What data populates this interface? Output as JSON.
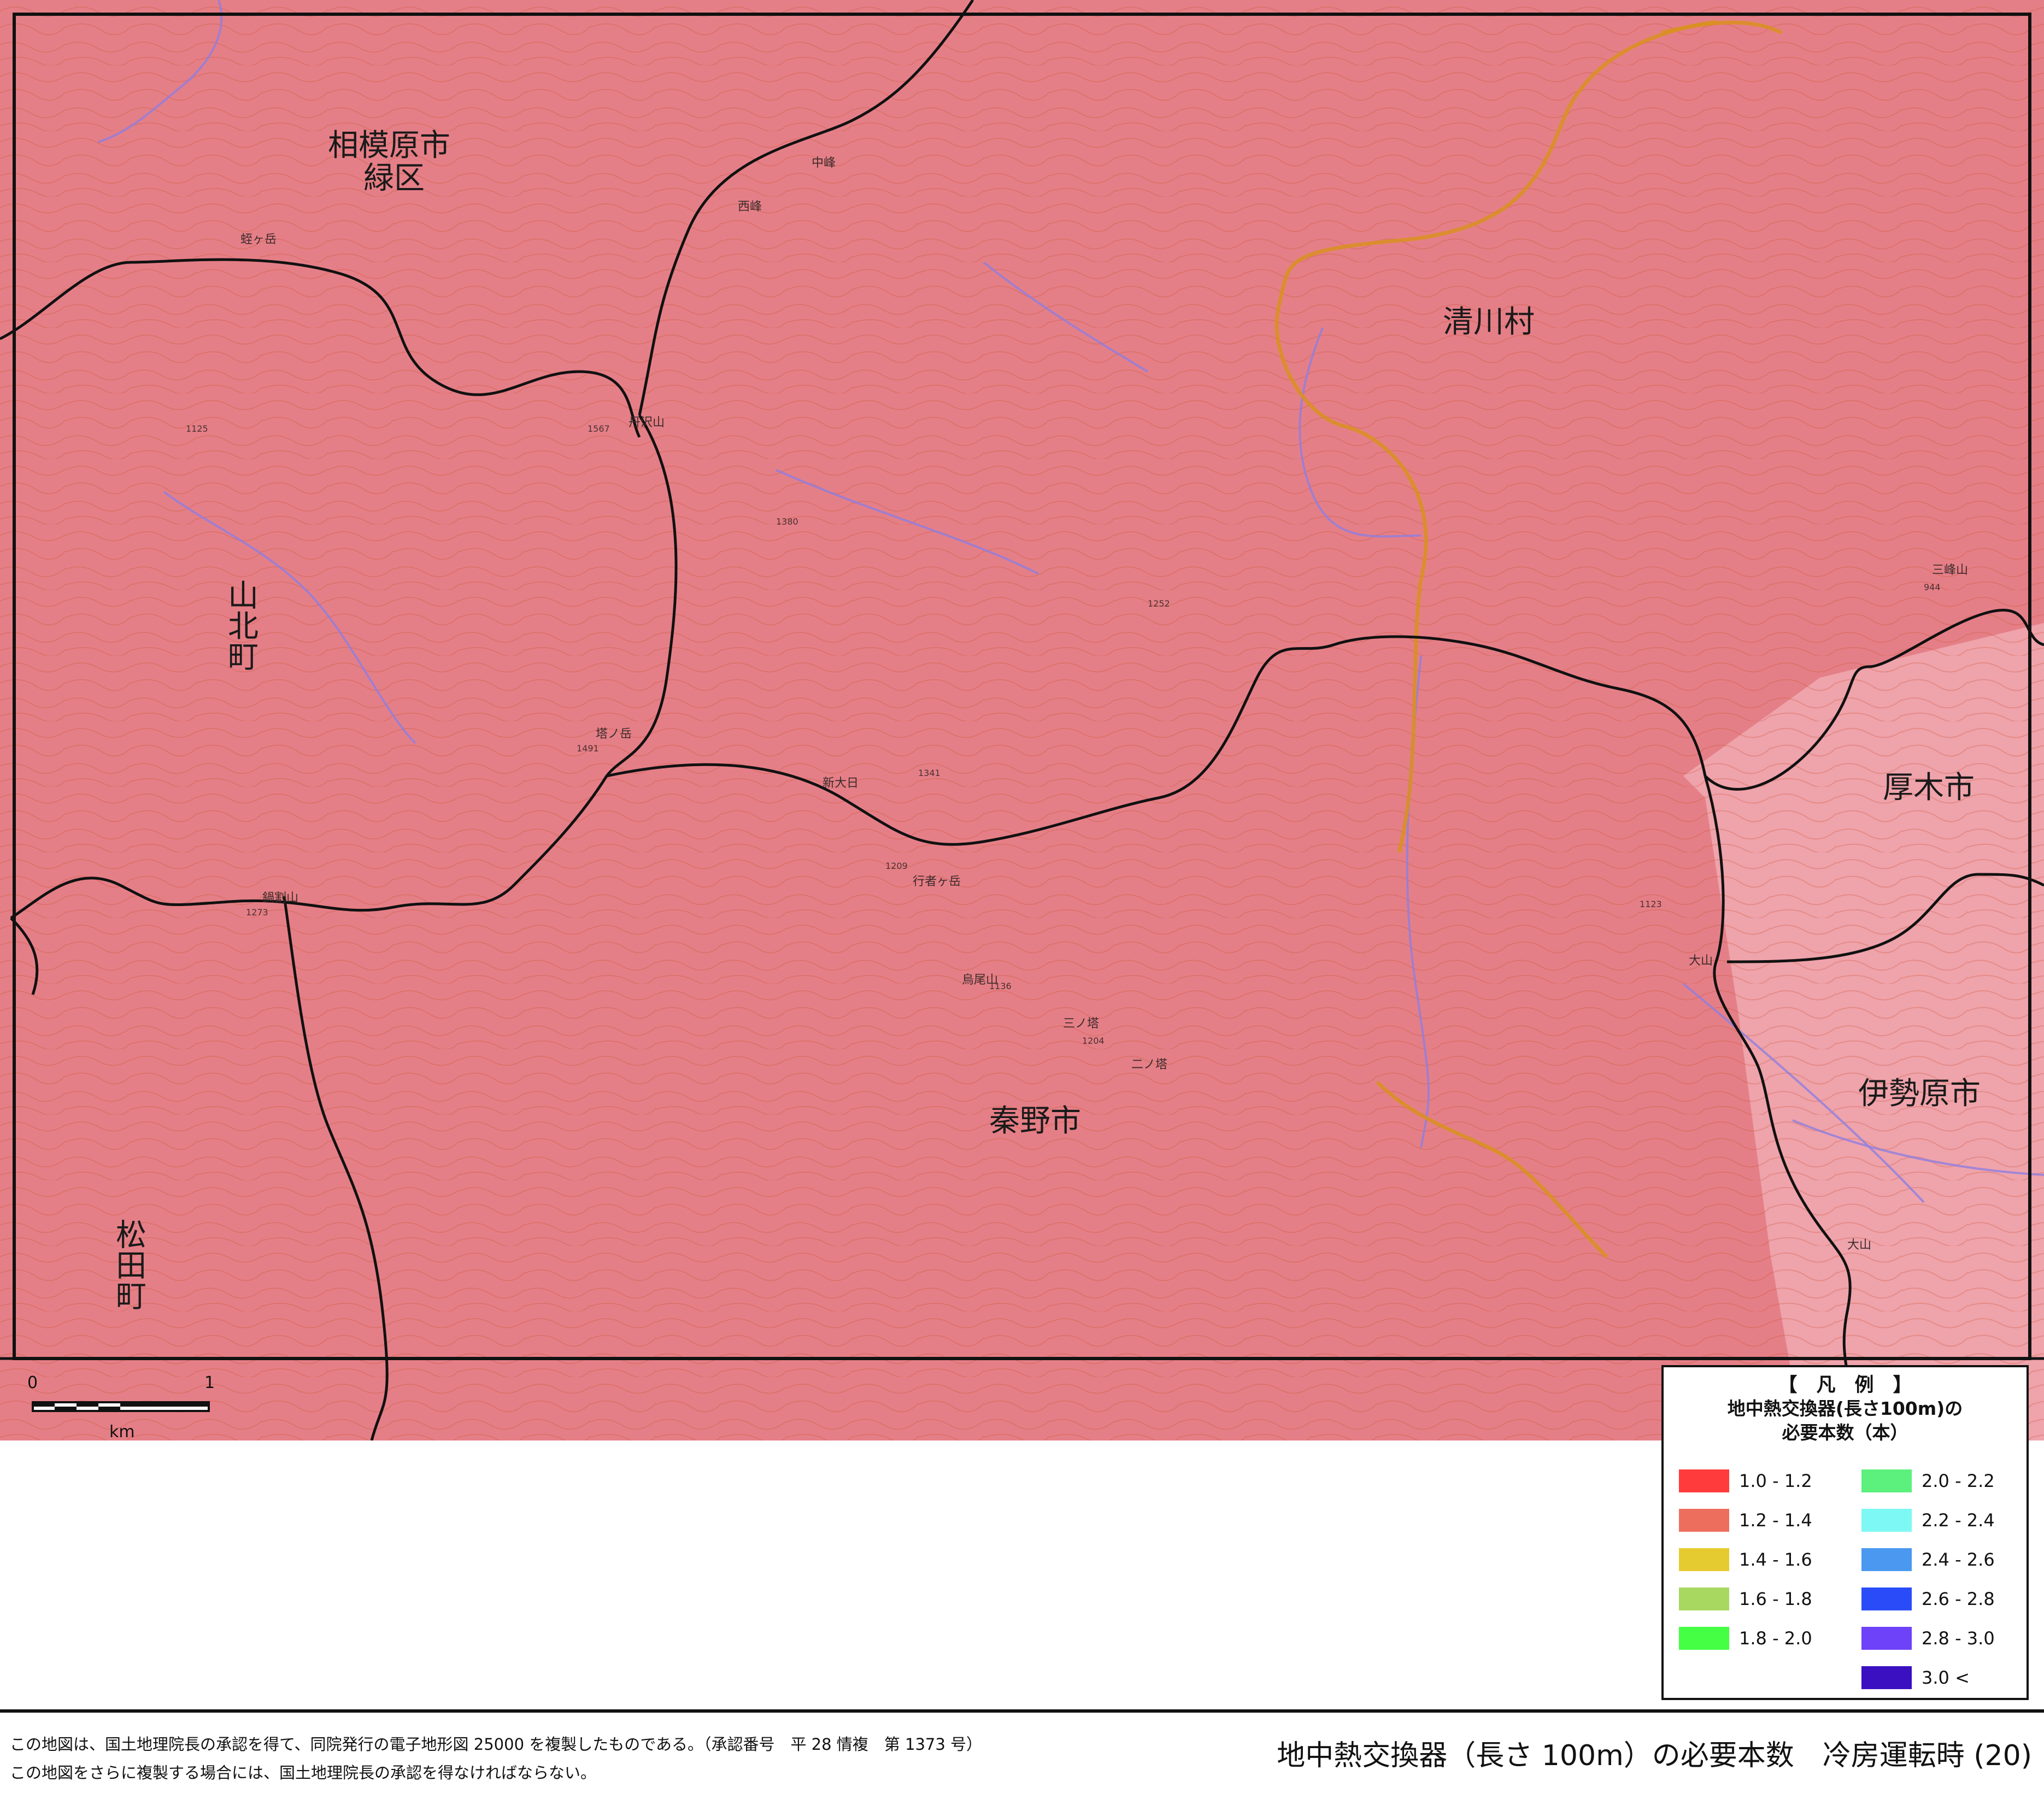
{
  "map": {
    "places": [
      {
        "name": "相模原市"
      },
      {
        "name": "緑区"
      },
      {
        "name": "清川村"
      },
      {
        "name": "山北町"
      },
      {
        "name": "厚木市"
      },
      {
        "name": "伊勢原市"
      },
      {
        "name": "秦野市"
      },
      {
        "name": "松田町"
      }
    ],
    "mountains": [
      "丹沢山",
      "塔ノ岳",
      "新大日",
      "鍋割山",
      "行者ヶ岳",
      "烏尾山",
      "三ノ塔",
      "二ノ塔",
      "大山",
      "三峰山",
      "丹沢",
      "中峰",
      "西峰",
      "蛭ヶ岳",
      "大山"
    ],
    "elevations": [
      "1567",
      "1491",
      "1341",
      "1209",
      "1273",
      "1136",
      "1204",
      "1252",
      "1125",
      "1380",
      "944",
      "1123"
    ],
    "fill_colors": {
      "dominant": "#e57f87",
      "lighter_zone": "#efa3ab"
    }
  },
  "scale_bar": {
    "start": "0",
    "end": "1",
    "unit": "km"
  },
  "legend": {
    "title": "【　凡　例　】",
    "subtitle_line1": "地中熱交換器(長さ100m)の",
    "subtitle_line2": "必要本数（本）",
    "items": [
      {
        "label": "1.0 - 1.2",
        "color": "#ff3b3b"
      },
      {
        "label": "1.2 - 1.4",
        "color": "#ee6e5e"
      },
      {
        "label": "1.4 - 1.6",
        "color": "#e6cb30"
      },
      {
        "label": "1.6 - 1.8",
        "color": "#a8d860"
      },
      {
        "label": "1.8 - 2.0",
        "color": "#44ff44"
      },
      {
        "label": "2.0 - 2.2",
        "color": "#5cf07c"
      },
      {
        "label": "2.2 - 2.4",
        "color": "#7ef8f4"
      },
      {
        "label": "2.4 - 2.6",
        "color": "#4a98f0"
      },
      {
        "label": "2.6 - 2.8",
        "color": "#2a4cf8"
      },
      {
        "label": "2.8 - 3.0",
        "color": "#6e42f8"
      },
      {
        "label": "3.0 <",
        "color": "#3a10c0"
      }
    ]
  },
  "footer": {
    "note1": "この地図は、国土地理院長の承認を得て、同院発行の電子地形図 25000 を複製したものである。（承認番号　平 28 情複　第 1373 号）",
    "note2": "この地図をさらに複製する場合には、国土地理院長の承認を得なければならない。",
    "title": "地中熱交換器（長さ 100m）の必要本数　冷房運転時 (20)"
  }
}
